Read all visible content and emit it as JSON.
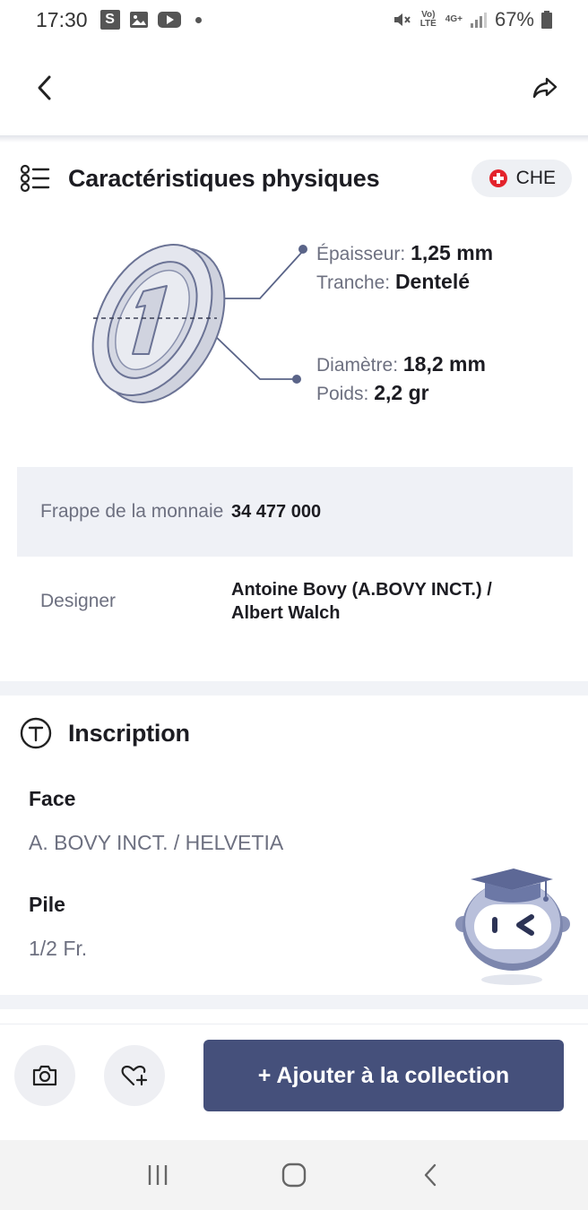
{
  "status_bar": {
    "time": "17:30",
    "s_badge": "S",
    "network_volte": "Vo) LTE",
    "network_4g": "4G+",
    "battery": "67%",
    "icons": [
      "s-app-icon",
      "gallery-icon",
      "youtube-icon",
      "dot-icon",
      "mute-icon",
      "volte-icon",
      "4g-icon",
      "signal-icon",
      "battery-icon"
    ]
  },
  "header": {
    "back_icon": "chevron-left-icon",
    "share_icon": "share-icon"
  },
  "physical": {
    "title": "Caractéristiques physiques",
    "country_code": "CHE",
    "specs": {
      "thickness_label": "Épaisseur:",
      "thickness_value": "1,25 mm",
      "edge_label": "Tranche:",
      "edge_value": "Dentelé",
      "diameter_label": "Diamètre:",
      "diameter_value": "18,2 mm",
      "weight_label": "Poids:",
      "weight_value": "2,2 gr"
    },
    "table": [
      {
        "label": "Frappe de la monnaie",
        "value": "34 477 000"
      },
      {
        "label": "Designer",
        "value": "Antoine Bovy (A.BOVY INCT.) / Albert Walch"
      }
    ]
  },
  "inscription": {
    "title": "Inscription",
    "face_label": "Face",
    "face_value": "A. BOVY INCT. / HELVETIA",
    "pile_label": "Pile",
    "pile_value": "1/2 Fr."
  },
  "actions": {
    "camera_icon": "camera-icon",
    "wishlist_icon": "heart-plus-icon",
    "add_label": "+ Ajouter à la collection"
  },
  "nav": {
    "recents": "recents-icon",
    "home": "home-icon",
    "back": "back-icon"
  },
  "colors": {
    "primary_button": "#45507b",
    "table_shade": "#eff1f6",
    "chip_bg": "#eef0f4",
    "swiss_red": "#e3232c",
    "muted_text": "#6d7080"
  }
}
